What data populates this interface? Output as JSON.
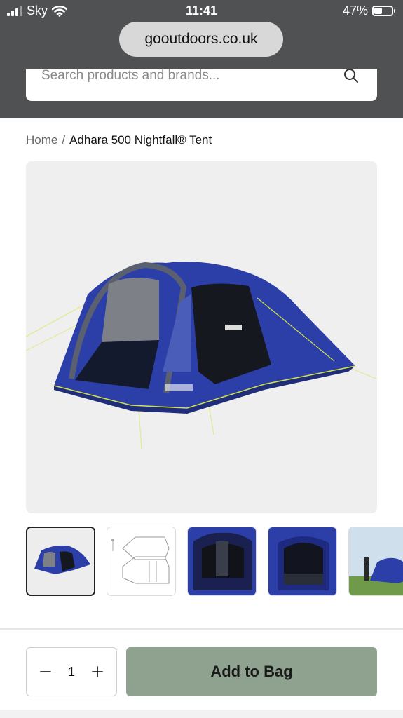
{
  "status_bar": {
    "carrier": "Sky",
    "time": "11:41",
    "battery": "47%",
    "battery_level": 0.47
  },
  "browser": {
    "url": "gooutdoors.co.uk"
  },
  "search": {
    "placeholder": "Search products and brands..."
  },
  "breadcrumb": {
    "home": "Home",
    "separator": "/",
    "current": "Adhara 500 Nightfall® Tent"
  },
  "gallery": {
    "main_image": "tent-product-image",
    "thumbnails": [
      {
        "name": "thumb-tent-exterior",
        "active": true
      },
      {
        "name": "thumb-tent-floorplan",
        "active": false
      },
      {
        "name": "thumb-tent-interior",
        "active": false
      },
      {
        "name": "thumb-tent-door",
        "active": false
      },
      {
        "name": "thumb-tent-outdoor",
        "active": false
      }
    ]
  },
  "purchase": {
    "quantity": "1",
    "decrement_icon": "minus-icon",
    "increment_icon": "plus-icon",
    "add_to_bag_label": "Add to Bag",
    "button_color": "#8fa28f"
  },
  "colors": {
    "header_bg": "#4f5153",
    "tent_blue": "#2c3fa8"
  }
}
